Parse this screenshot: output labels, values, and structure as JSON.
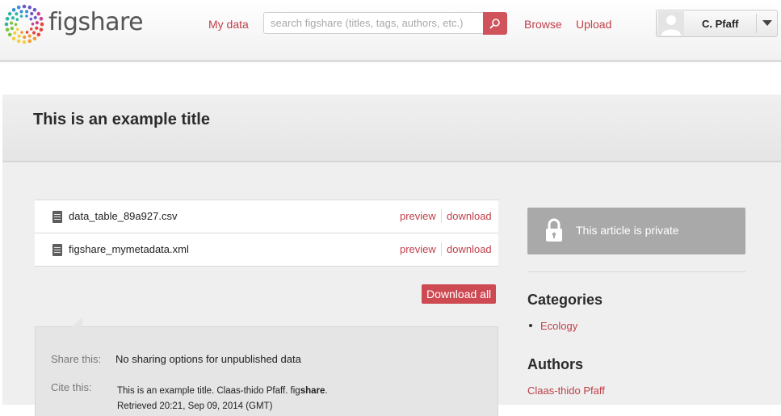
{
  "header": {
    "logo_text": "figshare",
    "nav_my_data": "My data",
    "search_placeholder": "search figshare (titles, tags, authors, etc.)",
    "nav_browse": "Browse",
    "nav_upload": "Upload",
    "user_name": "C. Pfaff"
  },
  "article": {
    "title": "This is an example title"
  },
  "files": [
    {
      "name": "data_table_89a927.csv",
      "preview": "preview",
      "download": "download"
    },
    {
      "name": "figshare_mymetadata.xml",
      "preview": "preview",
      "download": "download"
    }
  ],
  "download_all_label": "Download all",
  "share": {
    "share_label": "Share this:",
    "share_value": "No sharing options for unpublished data",
    "cite_label": "Cite this:",
    "cite_text_pre": "This is an example title. Claas-thido Pfaff. fig",
    "cite_text_bold": "share",
    "cite_text_post": ".",
    "cite_text_line2": "Retrieved 20:21, Sep 09, 2014 (GMT)"
  },
  "sidebar": {
    "private_text": "This article is private",
    "categories_heading": "Categories",
    "categories": [
      "Ecology"
    ],
    "authors_heading": "Authors",
    "authors": [
      "Claas-thido Pfaff"
    ]
  },
  "colors": {
    "accent": "#c0404a",
    "accent_button": "#cd4a53",
    "private_box": "#a9a9a9"
  },
  "icons": [
    "figshare-logo-icon",
    "search-icon",
    "user-avatar-icon",
    "chevron-down-icon",
    "file-icon",
    "lock-icon"
  ]
}
